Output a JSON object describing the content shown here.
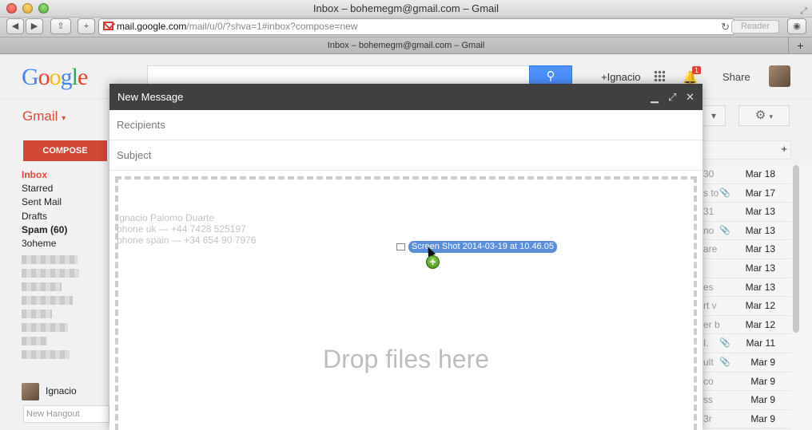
{
  "window": {
    "title": "Inbox – bohemegm@gmail.com – Gmail"
  },
  "browser": {
    "url_host": "mail.google.com",
    "url_path": "/mail/u/0/?shva=1#inbox?compose=new",
    "reader_label": "Reader",
    "tab_title": "Inbox – bohemegm@gmail.com – Gmail"
  },
  "header": {
    "logo": "Google",
    "user_link": "+Ignacio",
    "notif_count": "1",
    "share_label": "Share"
  },
  "gmail": {
    "app_label": "Gmail",
    "compose_label": "COMPOSE",
    "nav": [
      "Inbox",
      "Starred",
      "Sent Mail",
      "Drafts",
      "Spam (60)",
      "3oheme"
    ],
    "hangout_user": "Ignacio",
    "hangout_placeholder": "New Hangout"
  },
  "list": {
    "rows": [
      {
        "frag": "30",
        "date": "Mar 18",
        "clip": false
      },
      {
        "frag": "s to",
        "date": "Mar 17",
        "clip": true
      },
      {
        "frag": "31",
        "date": "Mar 13",
        "clip": false
      },
      {
        "frag": "no",
        "date": "Mar 13",
        "clip": true
      },
      {
        "frag": "are",
        "date": "Mar 13",
        "clip": false
      },
      {
        "frag": "",
        "date": "Mar 13",
        "clip": false
      },
      {
        "frag": "es",
        "date": "Mar 13",
        "clip": false
      },
      {
        "frag": "rt v",
        "date": "Mar 12",
        "clip": false
      },
      {
        "frag": "er b",
        "date": "Mar 12",
        "clip": false
      },
      {
        "frag": "I.",
        "date": "Mar 11",
        "clip": true
      },
      {
        "frag": "ult",
        "date": "Mar 9",
        "clip": true
      },
      {
        "frag": "co",
        "date": "Mar 9",
        "clip": false
      },
      {
        "frag": "ss",
        "date": "Mar 9",
        "clip": false
      },
      {
        "frag": "3r",
        "date": "Mar 9",
        "clip": false
      }
    ]
  },
  "compose": {
    "title": "New Message",
    "recipients_placeholder": "Recipients",
    "subject_placeholder": "Subject",
    "signature": [
      "Ignacio Palomo Duarte",
      "phone uk — +44 7428 525197",
      "phone spain — +34 654 90 7976"
    ],
    "drop_text": "Drop files here",
    "dragged_file": "Screen Shot 2014-03-19 at 10.46.05"
  }
}
